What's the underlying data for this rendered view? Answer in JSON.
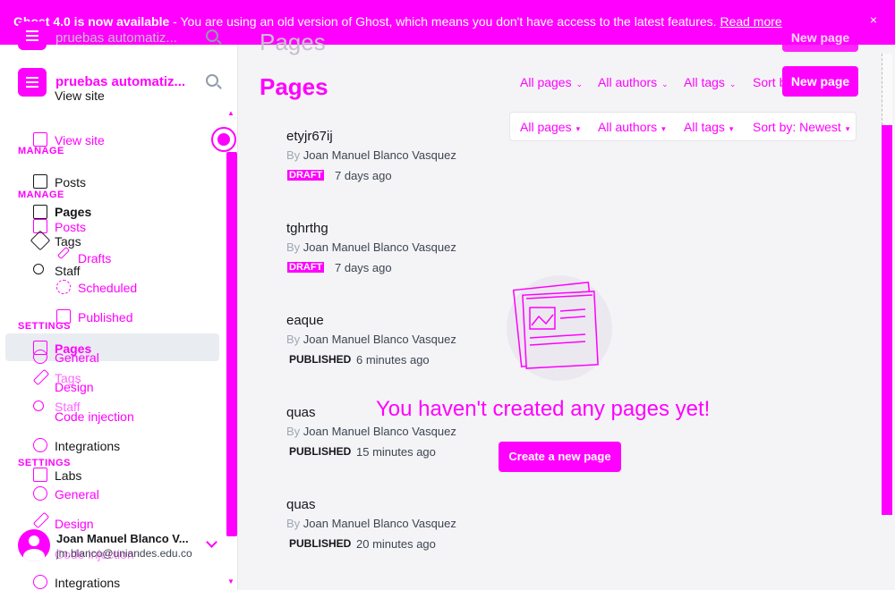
{
  "banner": {
    "bold": "Ghost 4.0 is now available",
    "text": " - You are using an old version of Ghost, which means you don't have access to the latest features. ",
    "link": "Read more",
    "close": "×"
  },
  "sidebar": {
    "brand": "pruebas automatiz...",
    "ghost_brand": "pruebas automatiz...",
    "view_site": "View site",
    "manage_label": "MANAGE",
    "settings_label": "SETTINGS",
    "items": {
      "posts": "Posts",
      "pages": "Pages",
      "tags": "Tags",
      "staff": "Staff",
      "drafts": "Drafts",
      "scheduled": "Scheduled",
      "published": "Published",
      "general": "General",
      "design": "Design",
      "code_injection": "Code injection",
      "integrations": "Integrations",
      "labs": "Labs"
    },
    "user": {
      "name": "Joan Manuel Blanco V...",
      "email": "jm.blanco@uniandes.edu.co",
      "ghost_email": "Code injection"
    }
  },
  "main": {
    "title": "Pages",
    "filters": {
      "all_pages": "All pages",
      "all_authors": "All authors",
      "all_tags": "All tags",
      "sort": "Sort by: Newest",
      "sort_short": "Sort b"
    },
    "new_page": "New page",
    "pages": [
      {
        "title": "etyjr67ij",
        "by": "By",
        "author": "Joan Manuel Blanco Vasquez",
        "status": "DRAFT",
        "time": "7 days ago"
      },
      {
        "title": "tghrthg",
        "by": "By",
        "author": "Joan Manuel Blanco Vasquez",
        "status": "DRAFT",
        "time": "7 days ago"
      },
      {
        "title": "eaque",
        "by": "By",
        "author": "Joan Manuel Blanco Vasquez",
        "status": "PUBLISHED",
        "time": "6 minutes ago"
      },
      {
        "title": "quas",
        "by": "By",
        "author": "Joan Manuel Blanco Vasquez",
        "status": "PUBLISHED",
        "time": "15 minutes ago"
      },
      {
        "title": "quas",
        "by": "By",
        "author": "Joan Manuel Blanco Vasquez",
        "status": "PUBLISHED",
        "time": "20 minutes ago"
      }
    ],
    "empty_message": "You haven't created any pages yet!",
    "create_button": "Create a new page"
  },
  "colors": {
    "accent": "#ff00ff"
  }
}
